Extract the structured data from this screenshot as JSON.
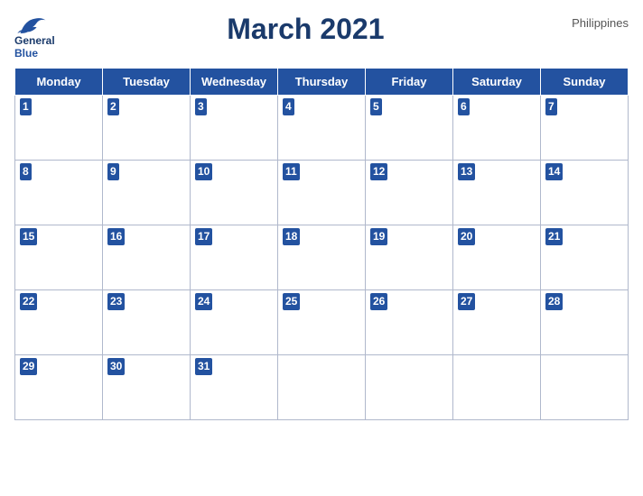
{
  "header": {
    "logo_line1": "General",
    "logo_line2": "Blue",
    "title": "March 2021",
    "country": "Philippines"
  },
  "weekdays": [
    "Monday",
    "Tuesday",
    "Wednesday",
    "Thursday",
    "Friday",
    "Saturday",
    "Sunday"
  ],
  "weeks": [
    [
      1,
      2,
      3,
      4,
      5,
      6,
      7
    ],
    [
      8,
      9,
      10,
      11,
      12,
      13,
      14
    ],
    [
      15,
      16,
      17,
      18,
      19,
      20,
      21
    ],
    [
      22,
      23,
      24,
      25,
      26,
      27,
      28
    ],
    [
      29,
      30,
      31,
      null,
      null,
      null,
      null
    ]
  ]
}
